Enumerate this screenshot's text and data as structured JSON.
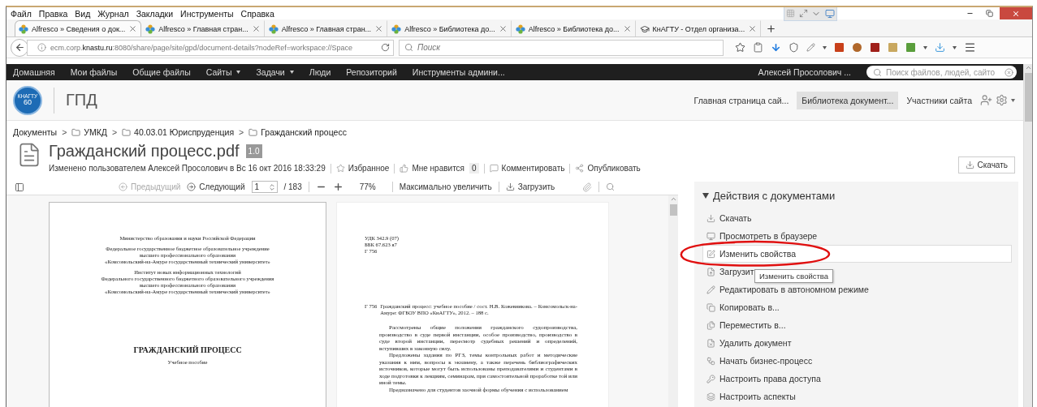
{
  "menu_bar": [
    "Файл",
    "Правка",
    "Вид",
    "Журнал",
    "Закладки",
    "Инструменты",
    "Справка"
  ],
  "tabs": [
    {
      "label": "Alfresco » Сведения о док...",
      "kind": "app",
      "selected": true
    },
    {
      "label": "Alfresco » Главная стран...",
      "kind": "app",
      "selected": false
    },
    {
      "label": "Alfresco » Главная стран...",
      "kind": "app",
      "selected": false
    },
    {
      "label": "Alfresco » Библиотека до...",
      "kind": "app",
      "selected": false
    },
    {
      "label": "Alfresco » Библиотека до...",
      "kind": "app",
      "selected": false
    },
    {
      "label": "КнАГТУ - Отдел организа...",
      "kind": "site",
      "selected": false
    }
  ],
  "address_bar": {
    "url": "ecm.corp.**knastu.ru**:8080/share/page/site/gpd/document-details?nodeRef=workspace://Space"
  },
  "browser_search": {
    "placeholder": "Поиск"
  },
  "app_nav": {
    "items": [
      {
        "label": "Домашняя",
        "dropdown": false
      },
      {
        "label": "Мои файлы",
        "dropdown": false
      },
      {
        "label": "Общие файлы",
        "dropdown": false
      },
      {
        "label": "Сайты",
        "dropdown": true
      },
      {
        "label": "Задачи",
        "dropdown": true
      },
      {
        "label": "Люди",
        "dropdown": false
      },
      {
        "label": "Репозиторий",
        "dropdown": false
      },
      {
        "label": "Инструменты админи...",
        "dropdown": false
      }
    ],
    "user": "Алексей Просолович ...",
    "search": {
      "placeholder": "Поиск файлов, людей, сайто"
    }
  },
  "site": {
    "logo_text": "КНАГТУ",
    "logo_number": "60",
    "title": "ГПД",
    "nav": [
      {
        "label": "Главная страница сай...",
        "selected": false
      },
      {
        "label": "Библиотека документ...",
        "selected": true
      },
      {
        "label": "Участники сайта",
        "selected": false
      }
    ]
  },
  "breadcrumb_separator": ">",
  "breadcrumb": [
    {
      "label": "Документы",
      "kind": "root"
    },
    {
      "label": "УМКД",
      "kind": "folder"
    },
    {
      "label": "40.03.01 Юриспруденция",
      "kind": "folder"
    },
    {
      "label": "Гражданский процесс",
      "kind": "folder"
    }
  ],
  "document": {
    "title": "Гражданский процесс.pdf",
    "version": "1.0",
    "modified": "Изменено пользователем Алексей Просолович в Вс 16 окт 2016 18:33:29",
    "actions": [
      {
        "label": "Избранное"
      },
      {
        "label": "Мне нравится",
        "count": "0"
      },
      {
        "label": "Комментировать"
      },
      {
        "label": "Опубликовать"
      }
    ]
  },
  "download_button": "Скачать",
  "viewer_toolbar": {
    "previous": {
      "label": "Предыдущий",
      "disabled": true
    },
    "next": {
      "label": "Следующий",
      "disabled": false
    },
    "page": "1",
    "total": "/ 183",
    "zoom": "77%",
    "maximize": "Максимально увеличить",
    "download": "Загрузить"
  },
  "pages": [
    {
      "lines": [
        {
          "kind": "center",
          "text": "Министерство образования и науки Российской Федерации"
        },
        {
          "kind": "gap"
        },
        {
          "kind": "center",
          "text": "Федеральное государственное бюджетное образовательное учреждение"
        },
        {
          "kind": "center",
          "text": "высшего профессионального образования"
        },
        {
          "kind": "center",
          "text": "«Комсомольский-на-Амуре государственный технический университет»"
        },
        {
          "kind": "gap"
        },
        {
          "kind": "center",
          "text": "Институт новых информационных технологий"
        },
        {
          "kind": "center",
          "text": "Федерального государственного бюджетного образовательного учреждения"
        },
        {
          "kind": "center",
          "text": "высшего профессионального образования"
        },
        {
          "kind": "center",
          "text": "«Комсомольский-на-Амуре государственный технический университет»"
        },
        {
          "kind": "space"
        },
        {
          "kind": "heading",
          "text": "ГРАЖДАНСКИЙ ПРОЦЕСС"
        },
        {
          "kind": "gap"
        },
        {
          "kind": "center",
          "text": "Учебное пособие"
        }
      ]
    },
    {
      "lines": [
        {
          "kind": "left",
          "text": "УДК 342.9 (07)"
        },
        {
          "kind": "left",
          "text": "ББК 67.623 я7"
        },
        {
          "kind": "left",
          "text": "Г 756"
        },
        {
          "kind": "space"
        },
        {
          "kind": "entry",
          "mark": "Г 756",
          "text": "Гражданский процесс: учебное пособие / сост. Н.В. Кожевникова. – Комсомольск-на-Амуре: ФГБОУ ВПО «КнАГТУ», 2012. – 188 с."
        },
        {
          "kind": "gap"
        },
        {
          "kind": "gap"
        },
        {
          "kind": "para",
          "text": "Рассмотрены общие положения гражданского судопроизводства, производство в суде первой инстанции, особое производство, производство в суде второй инстанции, пересмотр судебных решений и определений, вступивших в законную силу."
        },
        {
          "kind": "para",
          "text": "Предложены задания по РГЗ, темы контрольных работ и методические указания к ним, вопросы к экзамену, а также перечень библиографических источников, которые могут быть использованы преподавателями и студентами в ходе подготовки к лекциям, семинарам, при самостоятельной проработке той или иной темы."
        },
        {
          "kind": "para",
          "text": "Предназначено для студентов заочной формы обучения с использованием"
        }
      ]
    }
  ],
  "actions_panel": {
    "title": "Действия с документами",
    "expanded": true,
    "items": [
      {
        "label": "Скачать",
        "highlighted": false
      },
      {
        "label": "Просмотреть в браузере",
        "highlighted": false
      },
      {
        "label": "Изменить свойства",
        "highlighted": true
      },
      {
        "label": "Загрузит",
        "highlighted": false
      },
      {
        "label": "Редактировать в автономном режиме",
        "highlighted": false
      },
      {
        "label": "Копировать в...",
        "highlighted": false
      },
      {
        "label": "Переместить в...",
        "highlighted": false
      },
      {
        "label": "Удалить документ",
        "highlighted": false
      },
      {
        "label": "Начать бизнес-процесс",
        "highlighted": false
      },
      {
        "label": "Настроить права доступа",
        "highlighted": false
      },
      {
        "label": "Настроить аспекты",
        "highlighted": false
      }
    ],
    "tooltip": "Изменить свойства"
  }
}
